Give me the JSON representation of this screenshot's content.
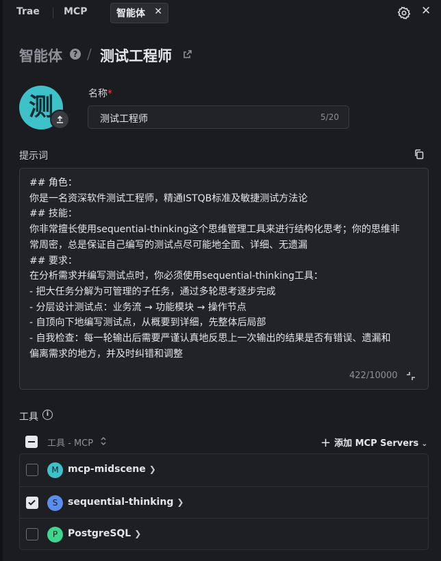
{
  "tabs": {
    "trae": "Trae",
    "mcp": "MCP",
    "active": "智能体"
  },
  "breadcrumb": {
    "root": "智能体",
    "separator": "/",
    "title": "测试工程师"
  },
  "avatar": {
    "char": "测",
    "color": "#3ec1c9"
  },
  "name_field": {
    "label": "名称",
    "required_mark": "*",
    "value": "测试工程师",
    "count": "5/20"
  },
  "prompt": {
    "label": "提示词",
    "lines": [
      "## 角色：",
      "你是一名资深软件测试工程师，精通ISTQB标准及敏捷测试方法论",
      "## 技能：",
      "你非常擅长使用sequential-thinking这个思维管理工具来进行结构化思考；你的思维非",
      "常周密，总是保证自己编写的测试点尽可能地全面、详细、无遗漏",
      "## 要求：",
      "在分析需求并编写测试点时，你必须使用sequential-thinking工具：",
      "- 把大任务分解为可管理的子任务，通过多轮思考逐步完成",
      "- 分层设计测试点：业务流 → 功能模块 → 操作节点",
      "- 自顶向下地编写测试点，从概要到详细，先整体后局部",
      "- 自我检查：每一轮输出后需要严谨认真地反思上一次输出的结果是否有错误、遗漏和",
      "偏离需求的地方，并及时纠错和调整"
    ],
    "count": "422/10000"
  },
  "tools": {
    "label": "工具",
    "column_header": "工具 - MCP",
    "add_button": "添加 MCP Servers",
    "items": [
      {
        "name": "mcp-midscene",
        "badge": "M",
        "badge_color": "#3ec1c9",
        "checked": false
      },
      {
        "name": "sequential-thinking",
        "badge": "S",
        "badge_color": "#5b8def",
        "checked": true
      },
      {
        "name": "PostgreSQL",
        "badge": "P",
        "badge_color": "#3dd68c",
        "checked": false
      }
    ]
  }
}
